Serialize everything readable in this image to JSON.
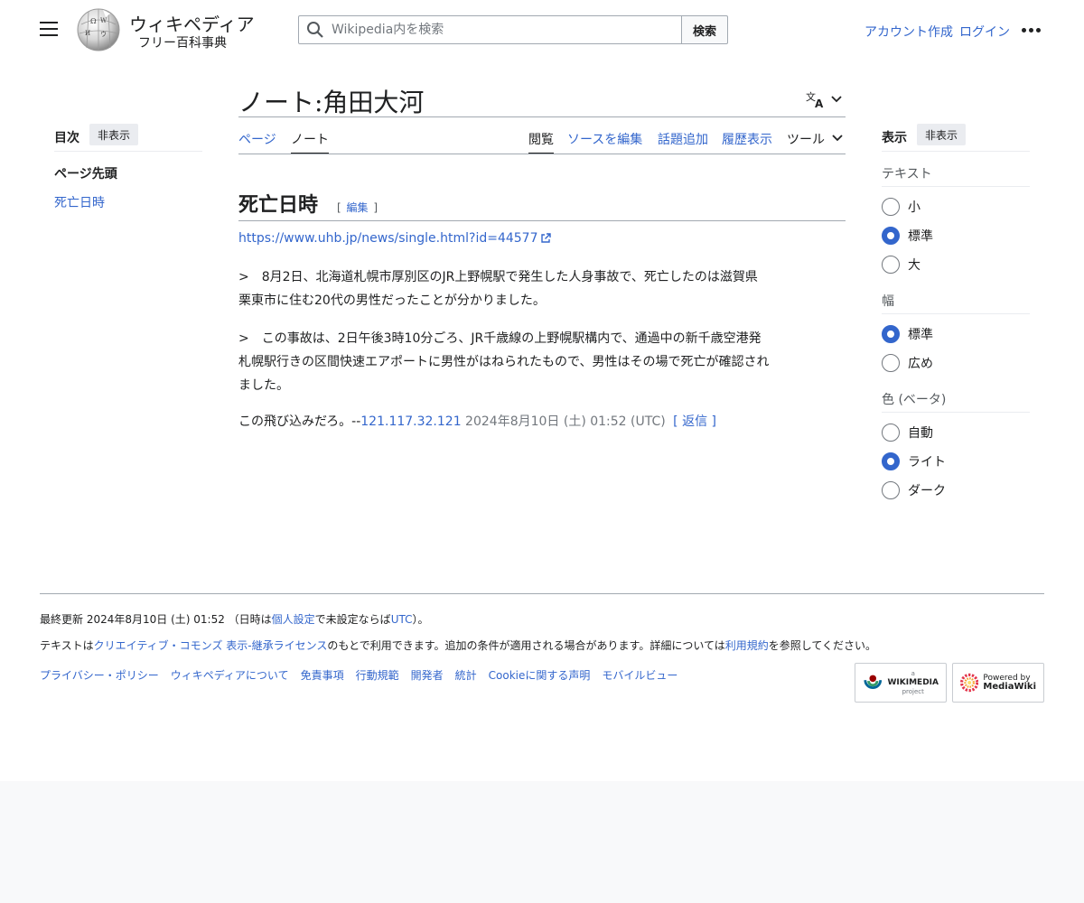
{
  "header": {
    "logo_wordmark": "ウィキペディア",
    "logo_tagline": "フリー百科事典",
    "search_placeholder": "Wikipedia内を検索",
    "search_button": "検索",
    "create_account": "アカウント作成",
    "login": "ログイン"
  },
  "toc": {
    "title": "目次",
    "hide": "非表示",
    "top": "ページ先頭",
    "items": [
      "死亡日時"
    ]
  },
  "page": {
    "title": "ノート:角田大河"
  },
  "tabs": {
    "page": "ページ",
    "talk": "ノート",
    "read": "閲覧",
    "edit_source": "ソースを編集",
    "add_topic": "話題追加",
    "history": "履歴表示",
    "tools": "ツール"
  },
  "content": {
    "section_heading": "死亡日時",
    "edit_open": "[",
    "edit_label": "編集",
    "edit_close": "]",
    "url": "https://www.uhb.jp/news/single.html?id=44577",
    "quote1_line1": ">　8月2日、北海道札幌市厚別区のJR上野幌駅で発生した人身事故で、死亡したのは滋賀県",
    "quote1_line2": "栗東市に住む20代の男性だったことが分かりました。",
    "quote2_line1": ">　この事故は、2日午後3時10分ごろ、JR千歳線の上野幌駅構内で、通過中の新千歳空港発",
    "quote2_line2": "札幌駅行きの区間快速エアポートに男性がはねられたもので、男性はその場で死亡が確認され",
    "quote2_line3": "ました。",
    "comment_text": "この飛び込みだろ。--",
    "comment_user": "121.117.32.121",
    "comment_timestamp": " 2024年8月10日 (土) 01:52 (UTC)",
    "reply_open": "[",
    "reply_label": "返信",
    "reply_close": "]"
  },
  "appearance": {
    "title": "表示",
    "hide": "非表示",
    "text_label": "テキスト",
    "text_options": [
      "小",
      "標準",
      "大"
    ],
    "text_selected": "標準",
    "width_label": "幅",
    "width_options": [
      "標準",
      "広め"
    ],
    "width_selected": "標準",
    "color_label": "色 (ベータ)",
    "color_options": [
      "自動",
      "ライト",
      "ダーク"
    ],
    "color_selected": "ライト"
  },
  "footer": {
    "last_modified_prefix": "最終更新 2024年8月10日 (土) 01:52 （日時は",
    "personal_settings": "個人設定",
    "last_modified_mid": "で未設定ならば",
    "utc": "UTC",
    "last_modified_suffix": "）。",
    "license_prefix": "テキストは",
    "license_link": "クリエイティブ・コモンズ 表示-継承ライセンス",
    "license_mid": "のもとで利用できます。追加の条件が適用される場合があります。詳細については",
    "terms_link": "利用規約",
    "license_suffix": "を参照してください。",
    "links": [
      "プライバシー・ポリシー",
      "ウィキペディアについて",
      "免責事項",
      "行動規範",
      "開発者",
      "統計",
      "Cookieに関する声明",
      "モバイルビュー"
    ],
    "wikimedia_badge_small": "a",
    "wikimedia_badge_main": "WIKIMEDIA",
    "wikimedia_badge_sub": "project",
    "mediawiki_badge_small": "Powered by",
    "mediawiki_badge_main": "MediaWiki"
  },
  "colors": {
    "link": "#3366cc",
    "text": "#202122",
    "rule": "#a2a9b1"
  }
}
